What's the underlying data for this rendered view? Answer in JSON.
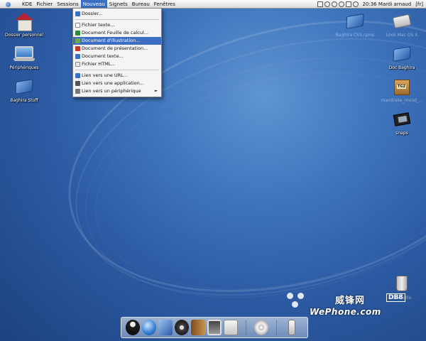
{
  "menubar": {
    "items": [
      "KDE",
      "Fichier",
      "Sessions",
      "Nouveau",
      "Signets",
      "Bureau",
      "Fenêtres"
    ],
    "active_index": 3,
    "clock": "20:36 Mardi arnaud",
    "lang": "[fr]"
  },
  "new_menu": {
    "items": [
      {
        "label": "Dossier...",
        "icon_color": "#3a6fc4"
      },
      {
        "label": "Fichier texte...",
        "icon_color": "#ffffff"
      },
      {
        "label": "Document Feuille de calcul...",
        "icon_color": "#2e8b3d"
      },
      {
        "label": "Document d'illustration...",
        "icon_color": "#6aa84f"
      },
      {
        "label": "Document de présentation...",
        "icon_color": "#c0392b"
      },
      {
        "label": "Document texte...",
        "icon_color": "#3a6fc4"
      },
      {
        "label": "Fichier HTML...",
        "icon_color": "#e8e8e8"
      },
      {
        "label": "Lien vers une URL...",
        "icon_color": "#3a6fc4"
      },
      {
        "label": "Lien vers une application...",
        "icon_color": "#555555"
      },
      {
        "label": "Lien vers un périphérique",
        "icon_color": "#777777",
        "submenu": "►"
      }
    ],
    "selected_index": 3
  },
  "desktop_left": [
    {
      "label": "Dossier personnel",
      "icon": "home-folder-icon"
    },
    {
      "label": "Périphériques",
      "icon": "laptop-icon"
    },
    {
      "label": "Baghira Stuff",
      "icon": "folder-icon"
    }
  ],
  "desktop_right": [
    {
      "label": "Baghira CVS.rpms",
      "icon": "folder-icon",
      "faded": true
    },
    {
      "label": "Look Mac OS X",
      "icon": "drive-icon",
      "faded": true
    },
    {
      "label": "Doc Baghira",
      "icon": "folder-icon",
      "faded": false
    },
    {
      "label": "mandrake_round_...",
      "icon": "tgz-package-icon",
      "faded": true
    },
    {
      "label": "snaps",
      "icon": "film-icon",
      "faded": false
    }
  ],
  "trash": {
    "label": "Corbeille",
    "icon": "trash-icon"
  },
  "watermark": {
    "cn": "威锋网",
    "badge": "DB8",
    "en": "WePhone.com"
  },
  "dock": {
    "items": [
      "tux-icon",
      "globe-icon",
      "mail-icon",
      "film-reel-icon",
      "book-icon",
      "photo-icon",
      "preview-icon"
    ],
    "right_items": [
      "cd-icon",
      "usb-drive-icon"
    ]
  }
}
